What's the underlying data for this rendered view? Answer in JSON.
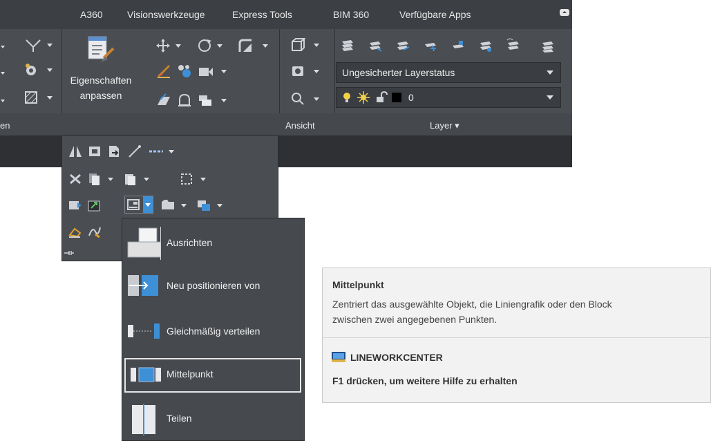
{
  "tabs": [
    "A360",
    "Visionswerkzeuge",
    "Express Tools",
    "BIM 360",
    "Verfügbare Apps"
  ],
  "ribbon": {
    "big_button_line1": "Eigenschaften",
    "big_button_line2": "anpassen",
    "layer_state": "Ungesicherter Layerstatus",
    "current_layer": "0",
    "panel_titles": {
      "left_fragment": "en",
      "view": "Ansicht",
      "layer": "Layer ▾"
    }
  },
  "flyout": {
    "items": [
      {
        "label": "Ausrichten",
        "icon": "align-icon"
      },
      {
        "label": "Neu positionieren von",
        "icon": "reposition-icon"
      },
      {
        "label": "Gleichmäßig verteilen",
        "icon": "distribute-icon"
      },
      {
        "label": "Mittelpunkt",
        "icon": "midpoint-icon",
        "selected": true
      },
      {
        "label": "Teilen",
        "icon": "split-icon"
      }
    ]
  },
  "tooltip": {
    "title": "Mittelpunkt",
    "description_line1": "Zentriert das ausgewählte Objekt, die Liniengrafik oder den Block",
    "description_line2": "zwischen zwei angegebenen Punkten.",
    "command": "LINEWORKCENTER",
    "help": "F1 drücken, um weitere Hilfe zu erhalten"
  },
  "colors": {
    "ribbon_bg": "#4a4d52",
    "tab_bar_bg": "#3c3f44",
    "accent_blue": "#3d8fd6",
    "tooltip_bg": "#f2f2f2"
  }
}
